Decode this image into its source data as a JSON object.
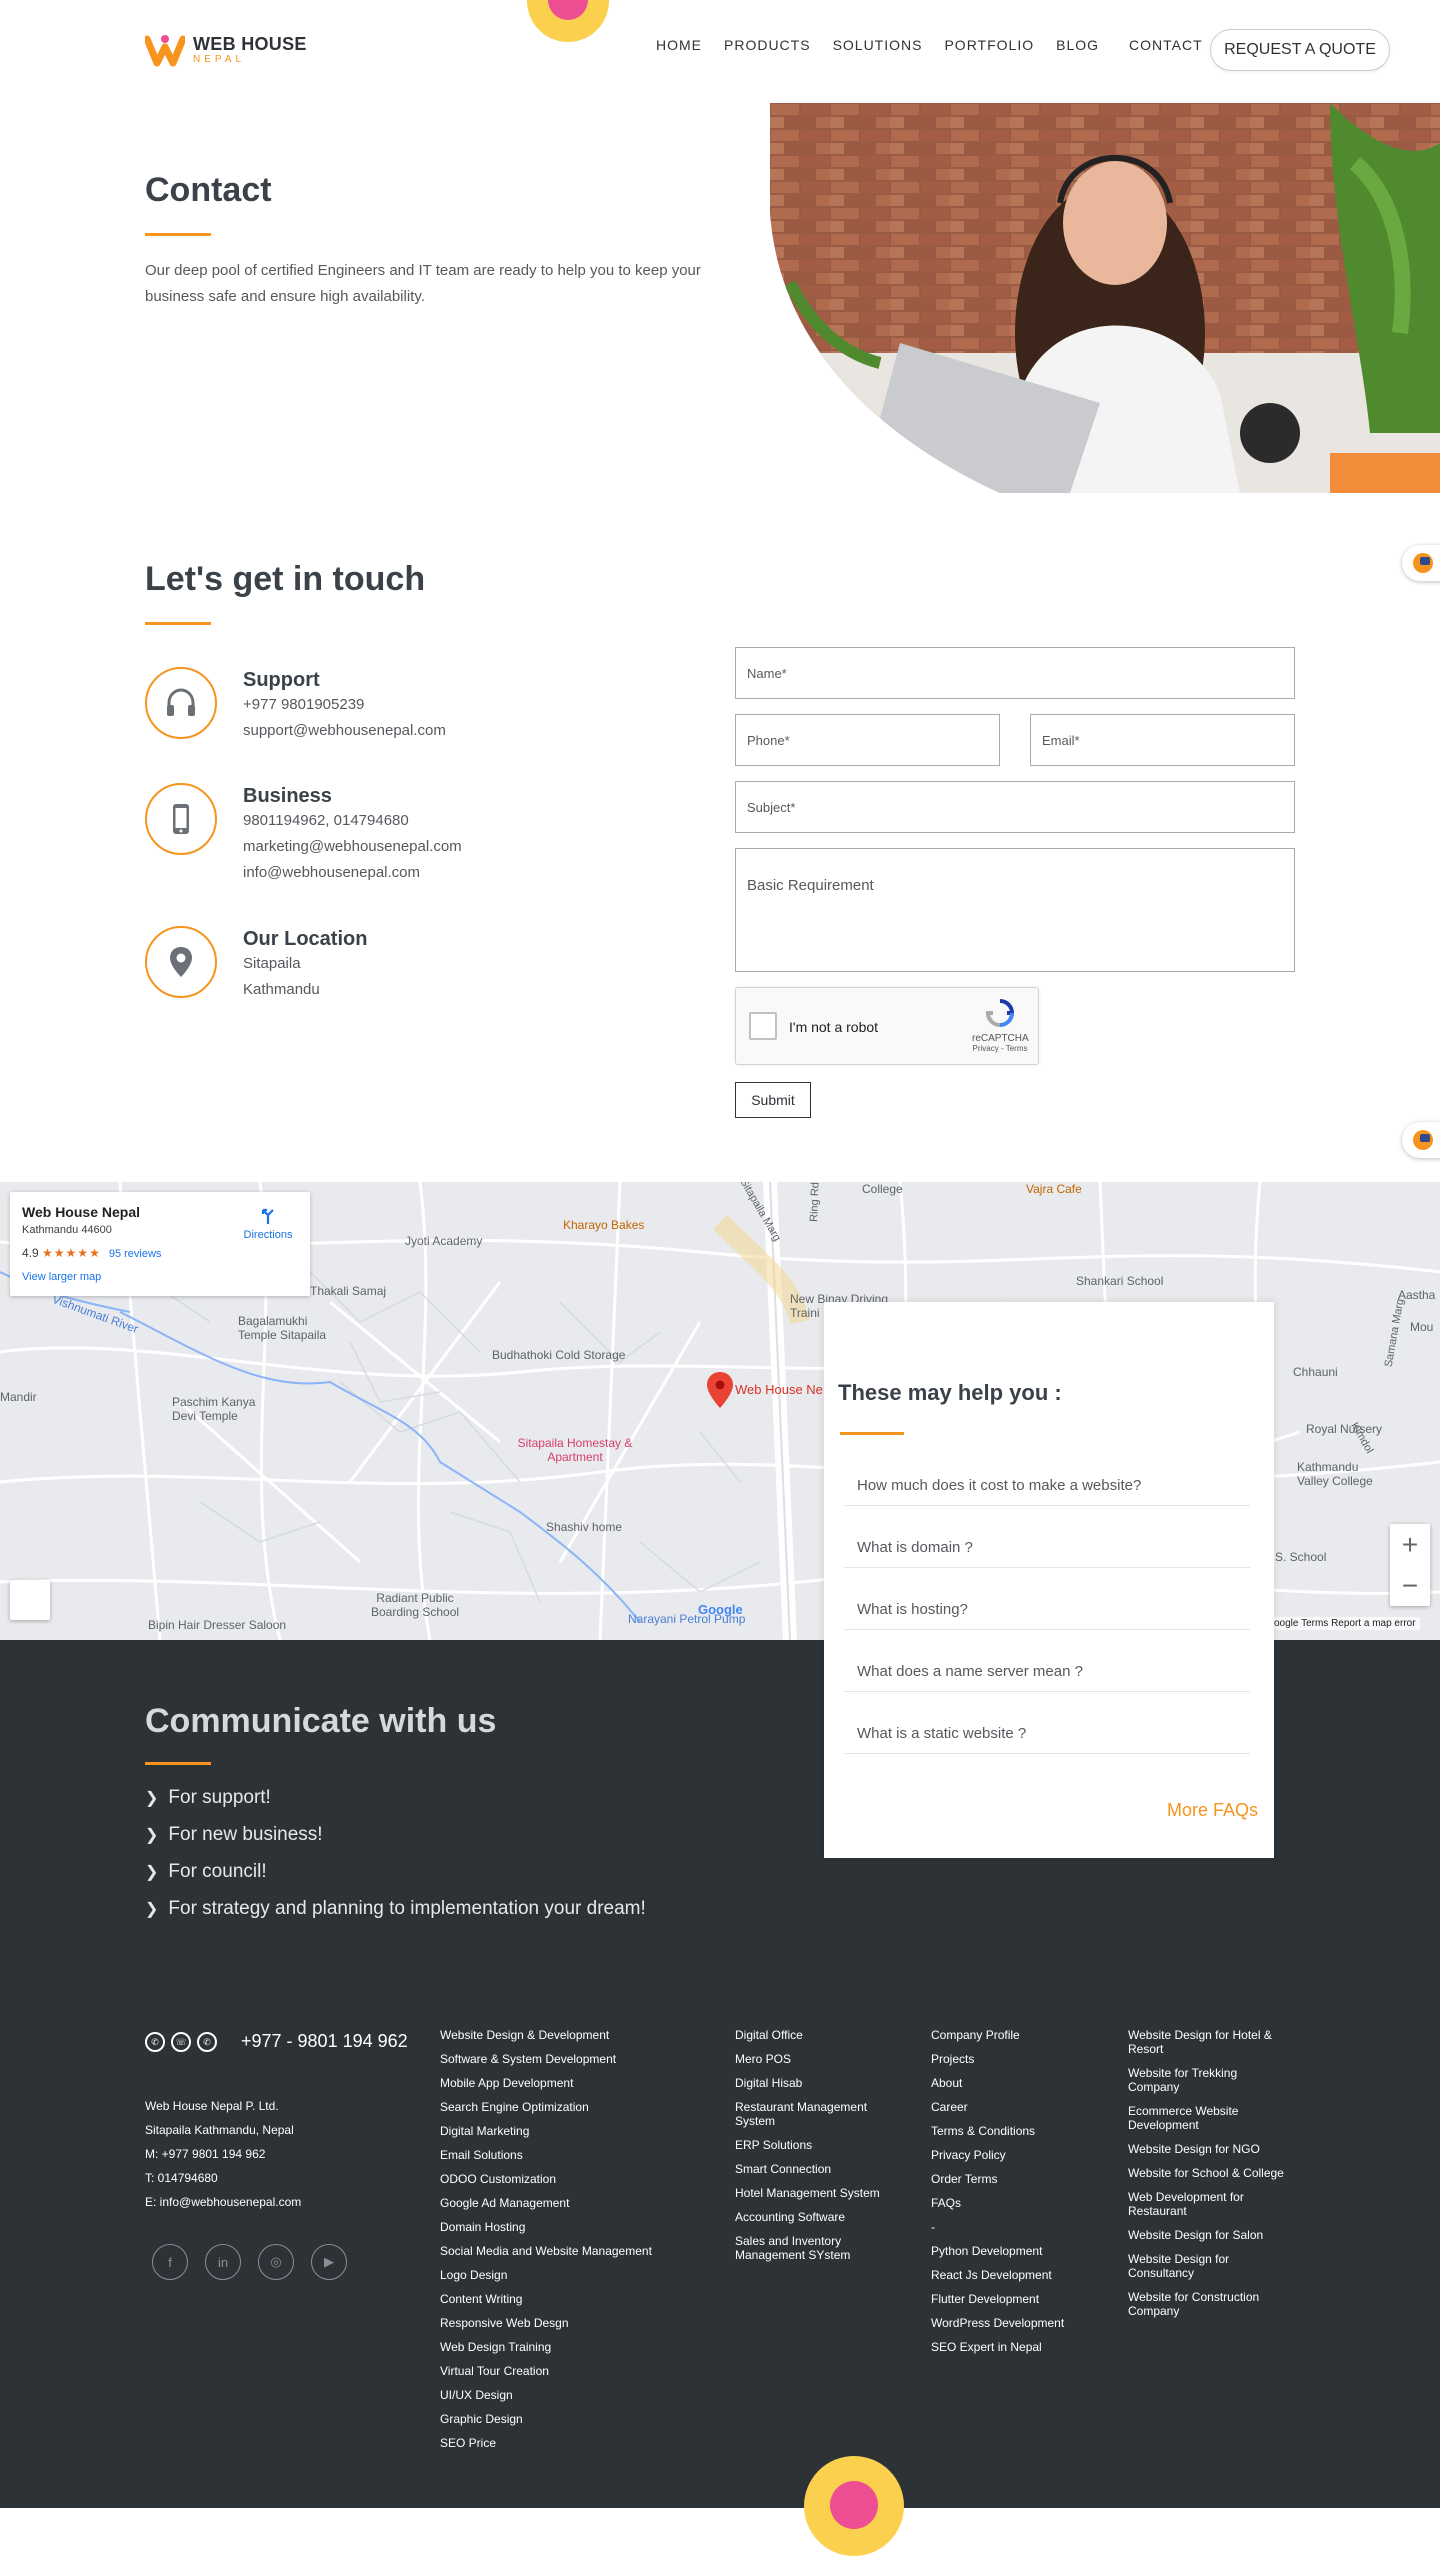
{
  "brand": {
    "name": "WEB HOUSE",
    "sub": "NEPAL"
  },
  "nav": {
    "items": [
      "HOME",
      "PRODUCTS",
      "SOLUTIONS",
      "PORTFOLIO",
      "BLOG",
      "CONTACT"
    ],
    "quote": "REQUEST A QUOTE"
  },
  "hero": {
    "title": "Contact",
    "desc": "Our deep pool of certified Engineers and IT team are ready to help you to keep your business safe and ensure high availability."
  },
  "touch": {
    "title": "Let's get in touch",
    "support": {
      "head": "Support",
      "lines": [
        "+977 9801905239",
        "support@webhousenepal.com"
      ]
    },
    "business": {
      "head": "Business",
      "lines": [
        "9801194962, 014794680",
        "marketing@webhousenepal.com",
        "info@webhousenepal.com"
      ]
    },
    "location": {
      "head": "Our Location",
      "lines": [
        "Sitapaila",
        "Kathmandu"
      ]
    }
  },
  "form": {
    "name": "Name*",
    "phone": "Phone*",
    "email": "Email*",
    "subject": "Subject*",
    "requirement": "Basic Requirement",
    "captcha_label": "I'm not a robot",
    "captcha_brand": "reCAPTCHA",
    "captcha_terms": "Privacy - Terms",
    "submit": "Submit"
  },
  "map": {
    "card_title": "Web House Nepal",
    "card_addr": "Kathmandu 44600",
    "rating": "4.9",
    "stars": "★★★★★",
    "reviews": "95 reviews",
    "larger": "View larger map",
    "directions": "Directions",
    "pin_label": "Web House Ne",
    "labels": [
      "Jyoti Academy",
      "Kharayo Bakes",
      "Sitapaila Marg",
      "Ring Rd",
      "College",
      "Vajra Cafe",
      "Shankari School",
      "New Binay Driving Traini",
      "Thakali Samaj",
      "Bagalamukhi Temple Sitapaila",
      "Budhathoki Cold Storage",
      "Vishnumati River",
      "Mandir",
      "Paschim Kanya Devi Temple",
      "Sitapaila Homestay & Apartment",
      "Shashiv home",
      "Radiant Public Boarding School",
      "Bipin Hair Dresser Saloon",
      "Narayani Petrol Pump",
      "Chhauni",
      "Royal Nursery",
      "Kathmandu Valley College",
      "S. School",
      "Aastha",
      "Mou",
      "Samana Marg",
      "Kimdol"
    ],
    "zoom_in": "+",
    "zoom_out": "−",
    "footer": "oogle   Terms   Report a map error",
    "google": "Google"
  },
  "faq": {
    "title": "These may help you :",
    "items": [
      "How much does it cost to make a website?",
      "What is domain ?",
      "What is hosting?",
      "What does a name server mean ?",
      "What is a static website ?"
    ],
    "more": "More FAQs"
  },
  "communicate": {
    "title": "Communicate with us",
    "items": [
      "For support!",
      "For new business!",
      "For council!",
      "For strategy and planning to implementation your dream!"
    ]
  },
  "footer": {
    "phone": "+977 - 9801 194 962",
    "info": [
      "Web House Nepal P. Ltd.",
      "Sitapaila Kathmandu, Nepal",
      "M: +977 9801 194 962",
      "T: 014794680",
      "E: info@webhousenepal.com"
    ],
    "col1": [
      "Website Design & Development",
      "Software & System Development",
      "Mobile App Development",
      "Search Engine Optimization",
      "Digital Marketing",
      "Email Solutions",
      "ODOO Customization",
      "Google Ad Management",
      "Domain Hosting",
      "Social Media and Website Management",
      "Logo Design",
      "Content Writing",
      "Responsive Web Desgn",
      "Web Design Training",
      "Virtual Tour Creation",
      "UI/UX Design",
      "Graphic Design",
      "SEO Price"
    ],
    "col2": [
      "Digital Office",
      "Mero POS",
      "Digital Hisab",
      "Restaurant Management System",
      "ERP Solutions",
      "Smart Connection",
      "Hotel Management System",
      "Accounting Software",
      "Sales and Inventory Management SYstem"
    ],
    "col3": [
      "Company Profile",
      "Projects",
      "About",
      "Career",
      "Terms & Conditions",
      "Privacy Policy",
      "Order Terms",
      "FAQs",
      "-",
      "Python Development",
      "React Js Development",
      "Flutter Development",
      "WordPress Development",
      "SEO Expert in Nepal"
    ],
    "col4": [
      "Website Design for Hotel & Resort",
      "Website for Trekking Company",
      "Ecommerce Website Development",
      "Website Design for NGO",
      "Website for School & College",
      "Web Development for Restaurant",
      "Website Design for Salon",
      "Website Design for Consultancy",
      "Website for Construction Company"
    ]
  },
  "colors": {
    "accent": "#f7941d",
    "dark": "#2d3237",
    "pink": "#ec4e91",
    "yellow": "#fcd04f"
  }
}
